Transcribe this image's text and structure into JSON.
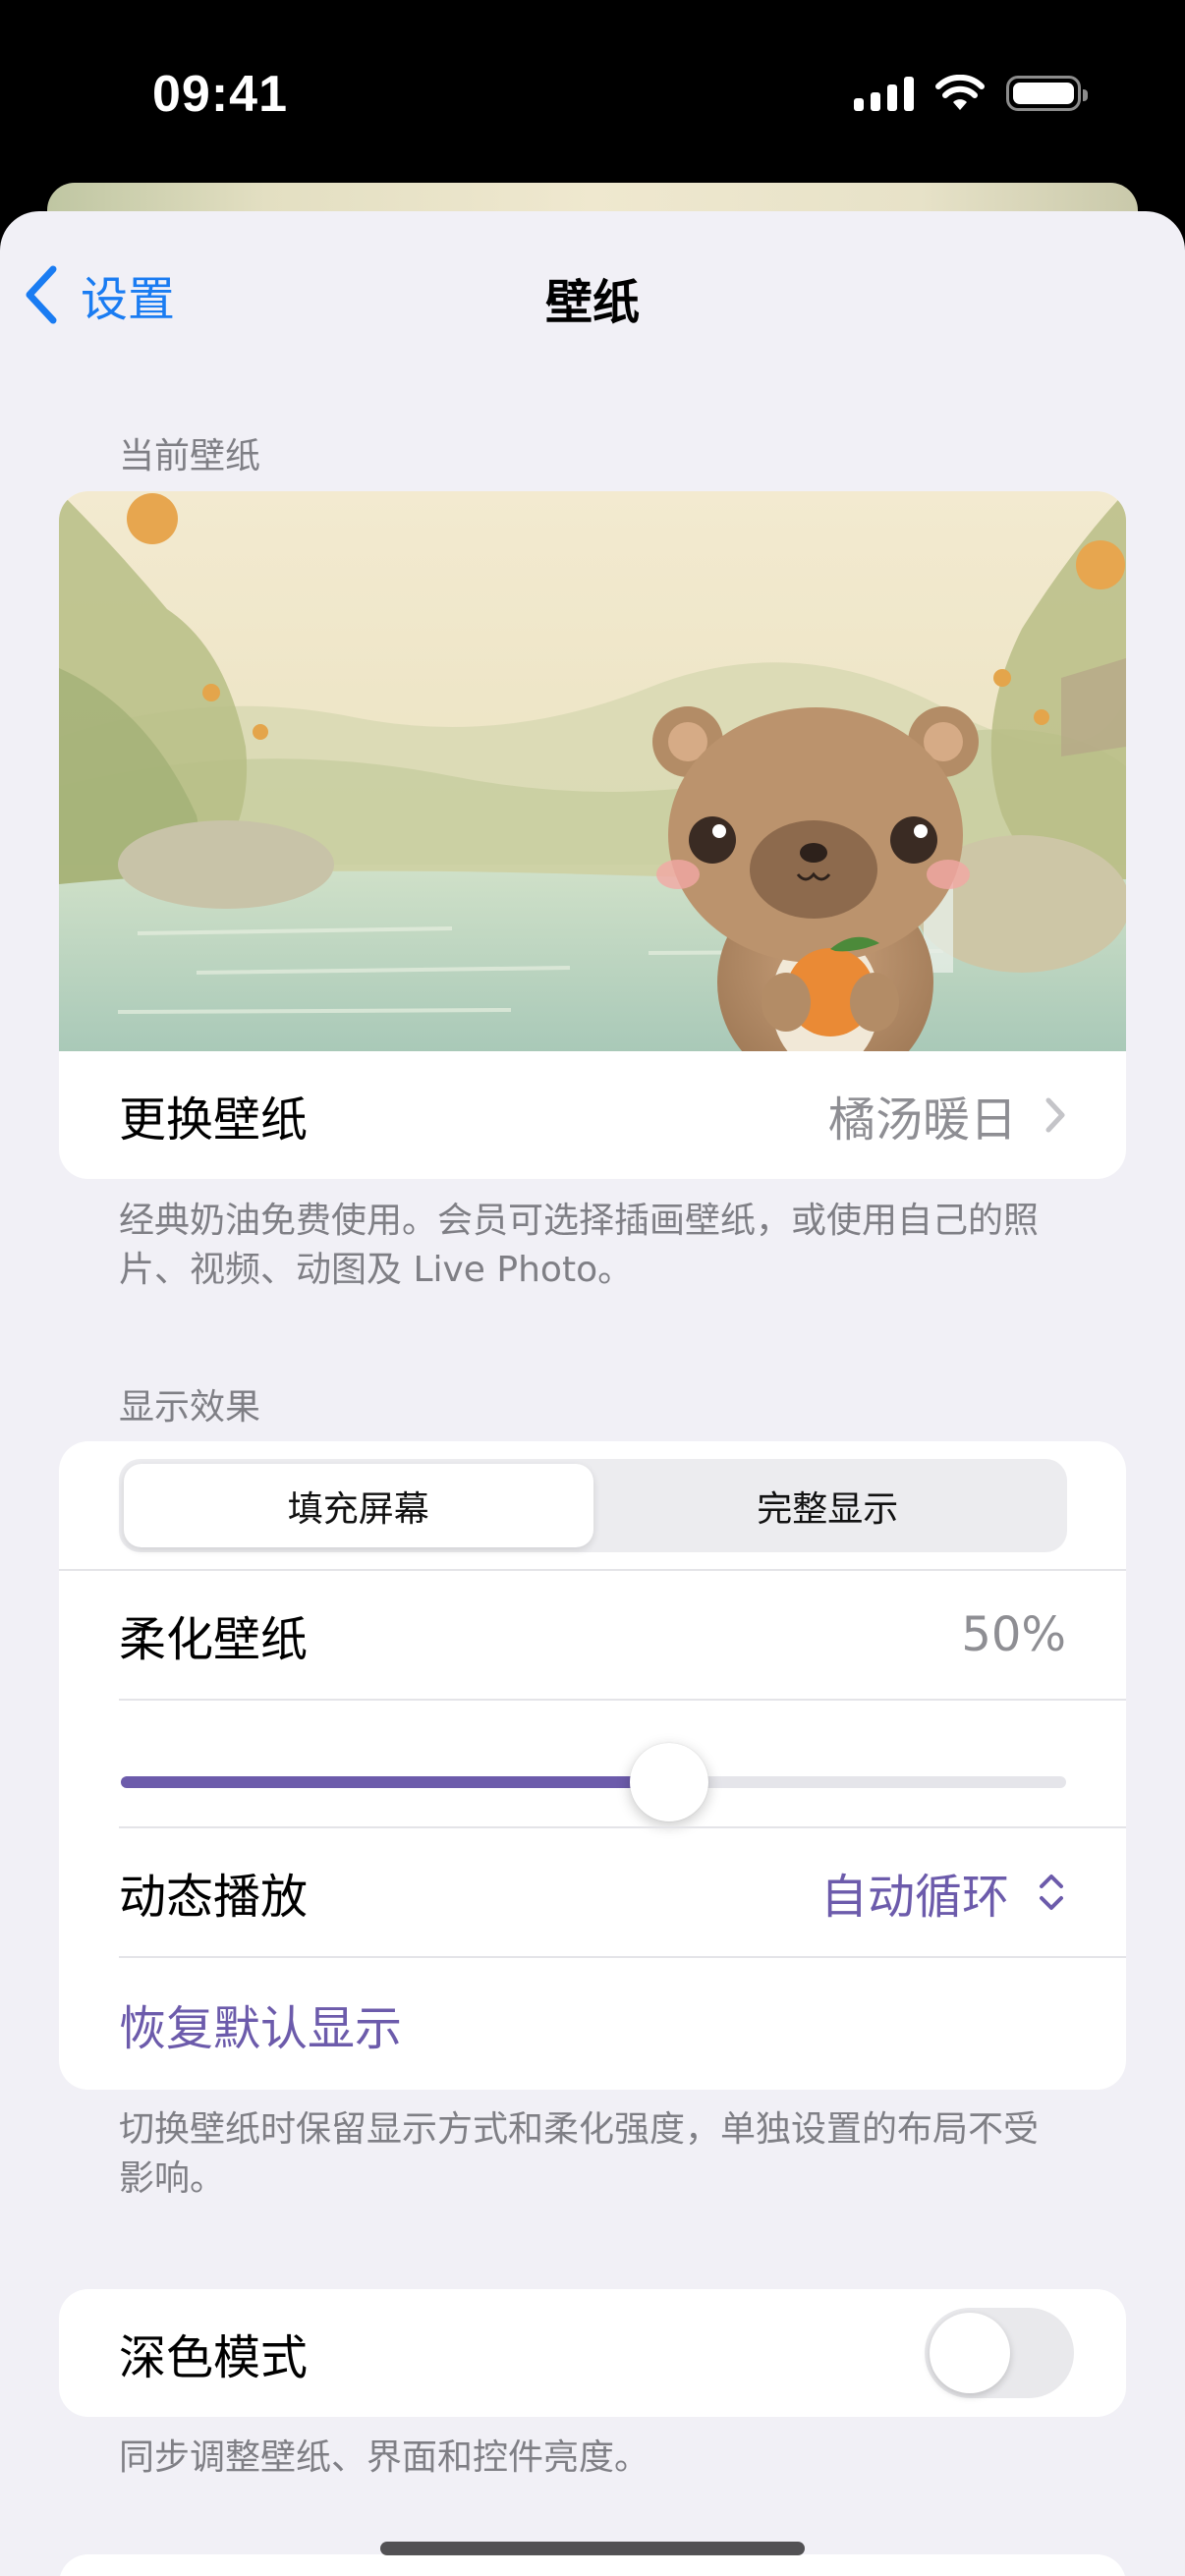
{
  "status_bar": {
    "time": "09:41"
  },
  "nav": {
    "back_label": "设置",
    "title": "壁纸"
  },
  "current_wallpaper": {
    "header": "当前壁纸",
    "change_label": "更换壁纸",
    "wallpaper_name": "橘汤暖日",
    "note": "经典奶油免费使用。会员可选择插画壁纸，或使用自己的照片、视频、动图及 Live Photo。"
  },
  "display": {
    "header": "显示效果",
    "segments": [
      "填充屏幕",
      "完整显示"
    ],
    "selected_segment": "填充屏幕",
    "soften_label": "柔化壁纸",
    "soften_value": "50%",
    "soften_fraction": 0.58,
    "playback_label": "动态播放",
    "playback_value": "自动循环",
    "restore_label": "恢复默认显示",
    "note": "切换壁纸时保留显示方式和柔化强度，单独设置的布局不受影响。"
  },
  "dark_mode": {
    "label": "深色模式",
    "enabled": false,
    "note": "同步调整壁纸、界面和控件亮度。"
  },
  "colors": {
    "accent_blue": "#1a7cf2",
    "accent_purple": "#6c5bab",
    "background": "#f1f0f6"
  },
  "icons": [
    "back-chevron-icon",
    "chevron-right-icon",
    "chevron-up-down-icon",
    "cellular-signal-icon",
    "wifi-icon",
    "battery-icon"
  ]
}
